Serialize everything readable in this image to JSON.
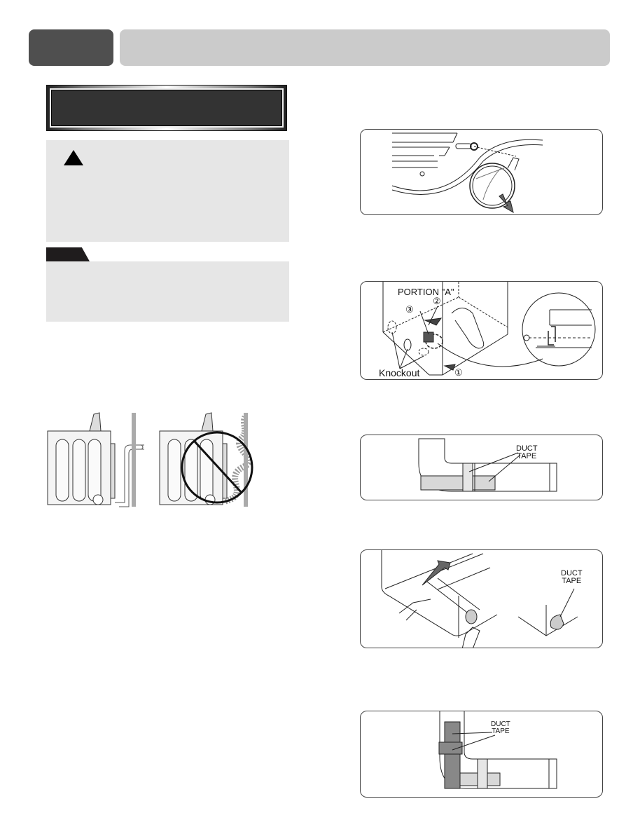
{
  "header": {
    "section_tab": "",
    "section_title": ""
  },
  "left_column": {
    "title_banner": "",
    "warning_box": {
      "icon": "warning-triangle-icon",
      "text": ""
    },
    "note_box": {
      "tab_label": "",
      "text": ""
    },
    "duct_comparison_figure": {
      "correct_install": "dryer with rigid duct to wall",
      "incorrect_install": "dryer with crushed flexible duct (prohibited)",
      "prohibited_icon": "no-symbol-icon"
    }
  },
  "right_column": {
    "figures": [
      {
        "id": "fig-remove-exhaust",
        "labels": []
      },
      {
        "id": "fig-knockout",
        "labels": {
          "portion": "PORTION \"A\"",
          "knockout": "Knockout",
          "step1": "①",
          "step2": "②",
          "step3": "③"
        }
      },
      {
        "id": "fig-duct-tape-elbow",
        "labels": {
          "duct_tape_line1": "DUCT",
          "duct_tape_line2": "TAPE"
        }
      },
      {
        "id": "fig-attach-duct",
        "labels": {
          "duct_tape_line1": "DUCT",
          "duct_tape_line2": "TAPE"
        }
      },
      {
        "id": "fig-duct-tape-vertical",
        "labels": {
          "duct_tape_line1": "DUCT",
          "duct_tape_line2": "TAPE"
        }
      }
    ]
  },
  "colors": {
    "header_tab": "#4f4f4f",
    "header_bar": "#cbcbcb",
    "banner_fill": "#333333",
    "box_fill": "#e6e6e6",
    "note_tab": "#1f1c1d"
  }
}
